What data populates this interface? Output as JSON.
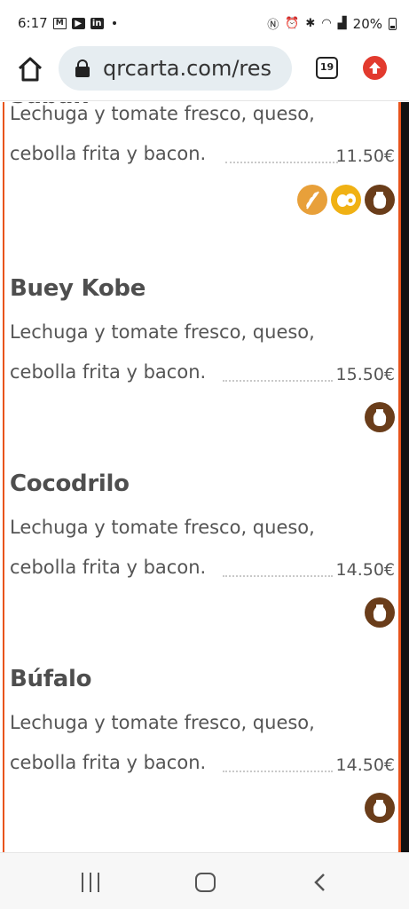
{
  "status_bar": {
    "time": "6:17",
    "battery": "20%",
    "left_icons": [
      "gmail-icon",
      "youtube-icon",
      "linkedin-icon",
      "dot-icon"
    ],
    "right_icons": [
      "nfc-icon",
      "alarm-icon",
      "bluetooth-icon",
      "wifi-icon",
      "signal-icon",
      "battery-icon"
    ]
  },
  "browser": {
    "url": "qrcarta.com/res",
    "tab_count": "19",
    "update_color": "#e23a2e"
  },
  "menu": {
    "accent_color": "#e8541c",
    "partial_item": {
      "name": "Saban",
      "desc_line1": "Lechuga y tomate fresco, queso,",
      "desc_line2": "cebolla frita y bacon.",
      "price": "11.50€",
      "allergens": [
        "gluten-icon",
        "egg-icon",
        "milk-icon"
      ]
    },
    "items": [
      {
        "name": "Buey Kobe",
        "desc_line1": "Lechuga y tomate fresco, queso,",
        "desc_line2": "cebolla frita y bacon.",
        "price": "15.50€",
        "allergens": [
          "milk-icon"
        ]
      },
      {
        "name": "Cocodrilo",
        "desc_line1": "Lechuga y tomate fresco, queso,",
        "desc_line2": "cebolla frita y bacon.",
        "price": "14.50€",
        "allergens": [
          "milk-icon"
        ]
      },
      {
        "name": "Búfalo",
        "desc_line1": "Lechuga y tomate fresco, queso,",
        "desc_line2": "cebolla frita y bacon.",
        "price": "14.50€",
        "allergens": [
          "milk-icon"
        ]
      }
    ]
  },
  "nav_bar": {
    "buttons": [
      "recent-apps-icon",
      "home-icon",
      "back-icon"
    ]
  }
}
